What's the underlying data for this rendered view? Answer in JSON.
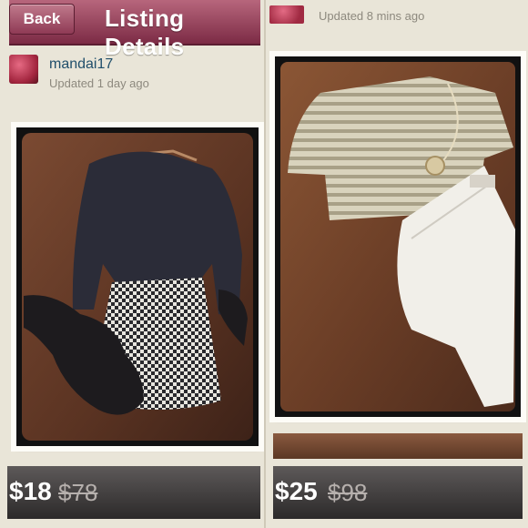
{
  "left_listing": {
    "header": {
      "back_label": "Back",
      "title": "Listing Details"
    },
    "user": {
      "name": "mandai17",
      "updated": "Updated 1 day ago"
    },
    "price": {
      "current": "$18",
      "original": "$78"
    }
  },
  "right_listing": {
    "user": {
      "updated": "Updated 8 mins ago"
    },
    "price": {
      "current": "$25",
      "original": "$98"
    }
  },
  "colors": {
    "accent": "#8f3a55",
    "username": "#214f6b",
    "price_bar": "#2c2a2a"
  }
}
